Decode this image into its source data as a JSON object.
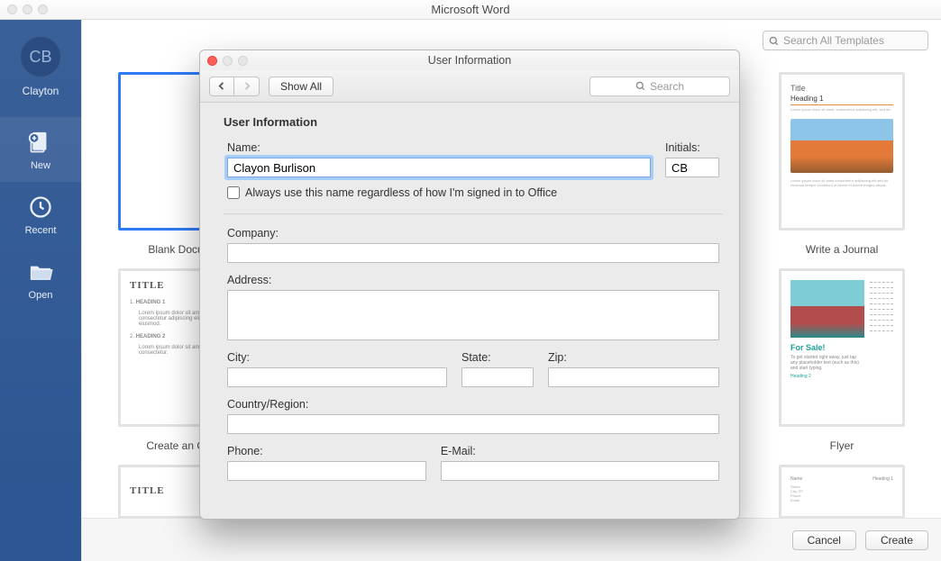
{
  "window": {
    "title": "Microsoft Word"
  },
  "sidebar": {
    "avatar_initials": "CB",
    "avatar_name": "Clayton",
    "items": [
      {
        "label": "New"
      },
      {
        "label": "Recent"
      },
      {
        "label": "Open"
      }
    ]
  },
  "search_templates": {
    "placeholder": "Search All Templates"
  },
  "templates": {
    "col1": [
      {
        "label": "Blank Docu…"
      },
      {
        "label": "Create an O…",
        "title": "TITLE",
        "sub1": "HEADING 1",
        "sub2": "HEADING 2"
      },
      {
        "label": "",
        "title": "TITLE"
      }
    ],
    "col2": [
      {
        "label": "Write a Journal",
        "jt": "Title",
        "jh": "Heading 1"
      },
      {
        "label": "Flyer",
        "fs": "For Sale!",
        "fp": "To get started right away, just tap any placeholder text (such as this) and start typing.",
        "fp2": "Heading 2"
      },
      {
        "label": ""
      }
    ]
  },
  "buttons": {
    "cancel": "Cancel",
    "create": "Create"
  },
  "modal": {
    "title": "User Information",
    "toolbar": {
      "show_all": "Show All",
      "search_placeholder": "Search"
    },
    "section_title": "User Information",
    "labels": {
      "name": "Name:",
      "initials": "Initials:",
      "always": "Always use this name regardless of how I'm signed in to Office",
      "company": "Company:",
      "address": "Address:",
      "city": "City:",
      "state": "State:",
      "zip": "Zip:",
      "country": "Country/Region:",
      "phone": "Phone:",
      "email": "E-Mail:"
    },
    "values": {
      "name": "Clayon Burlison",
      "initials": "CB",
      "company": "",
      "address": "",
      "city": "",
      "state": "",
      "zip": "",
      "country": "",
      "phone": "",
      "email": ""
    }
  }
}
